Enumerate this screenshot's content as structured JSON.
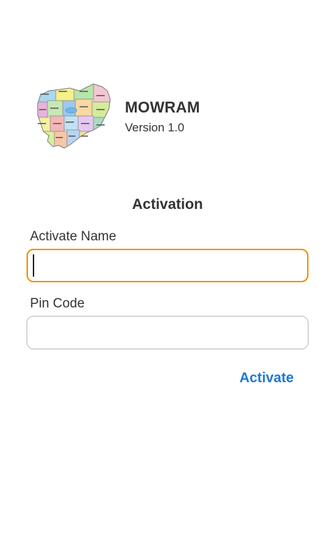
{
  "app": {
    "name": "MOWRAM",
    "version": "Version 1.0",
    "logo_icon": "cambodia-province-map-icon"
  },
  "form": {
    "title": "Activation",
    "name_label": "Activate Name",
    "name_value": "",
    "name_placeholder": "",
    "pin_label": "Pin Code",
    "pin_value": "",
    "pin_placeholder": "",
    "submit_label": "Activate"
  },
  "colors": {
    "accent_button": "#1e78d2",
    "focus_border": "#f29100",
    "text": "#333333"
  }
}
